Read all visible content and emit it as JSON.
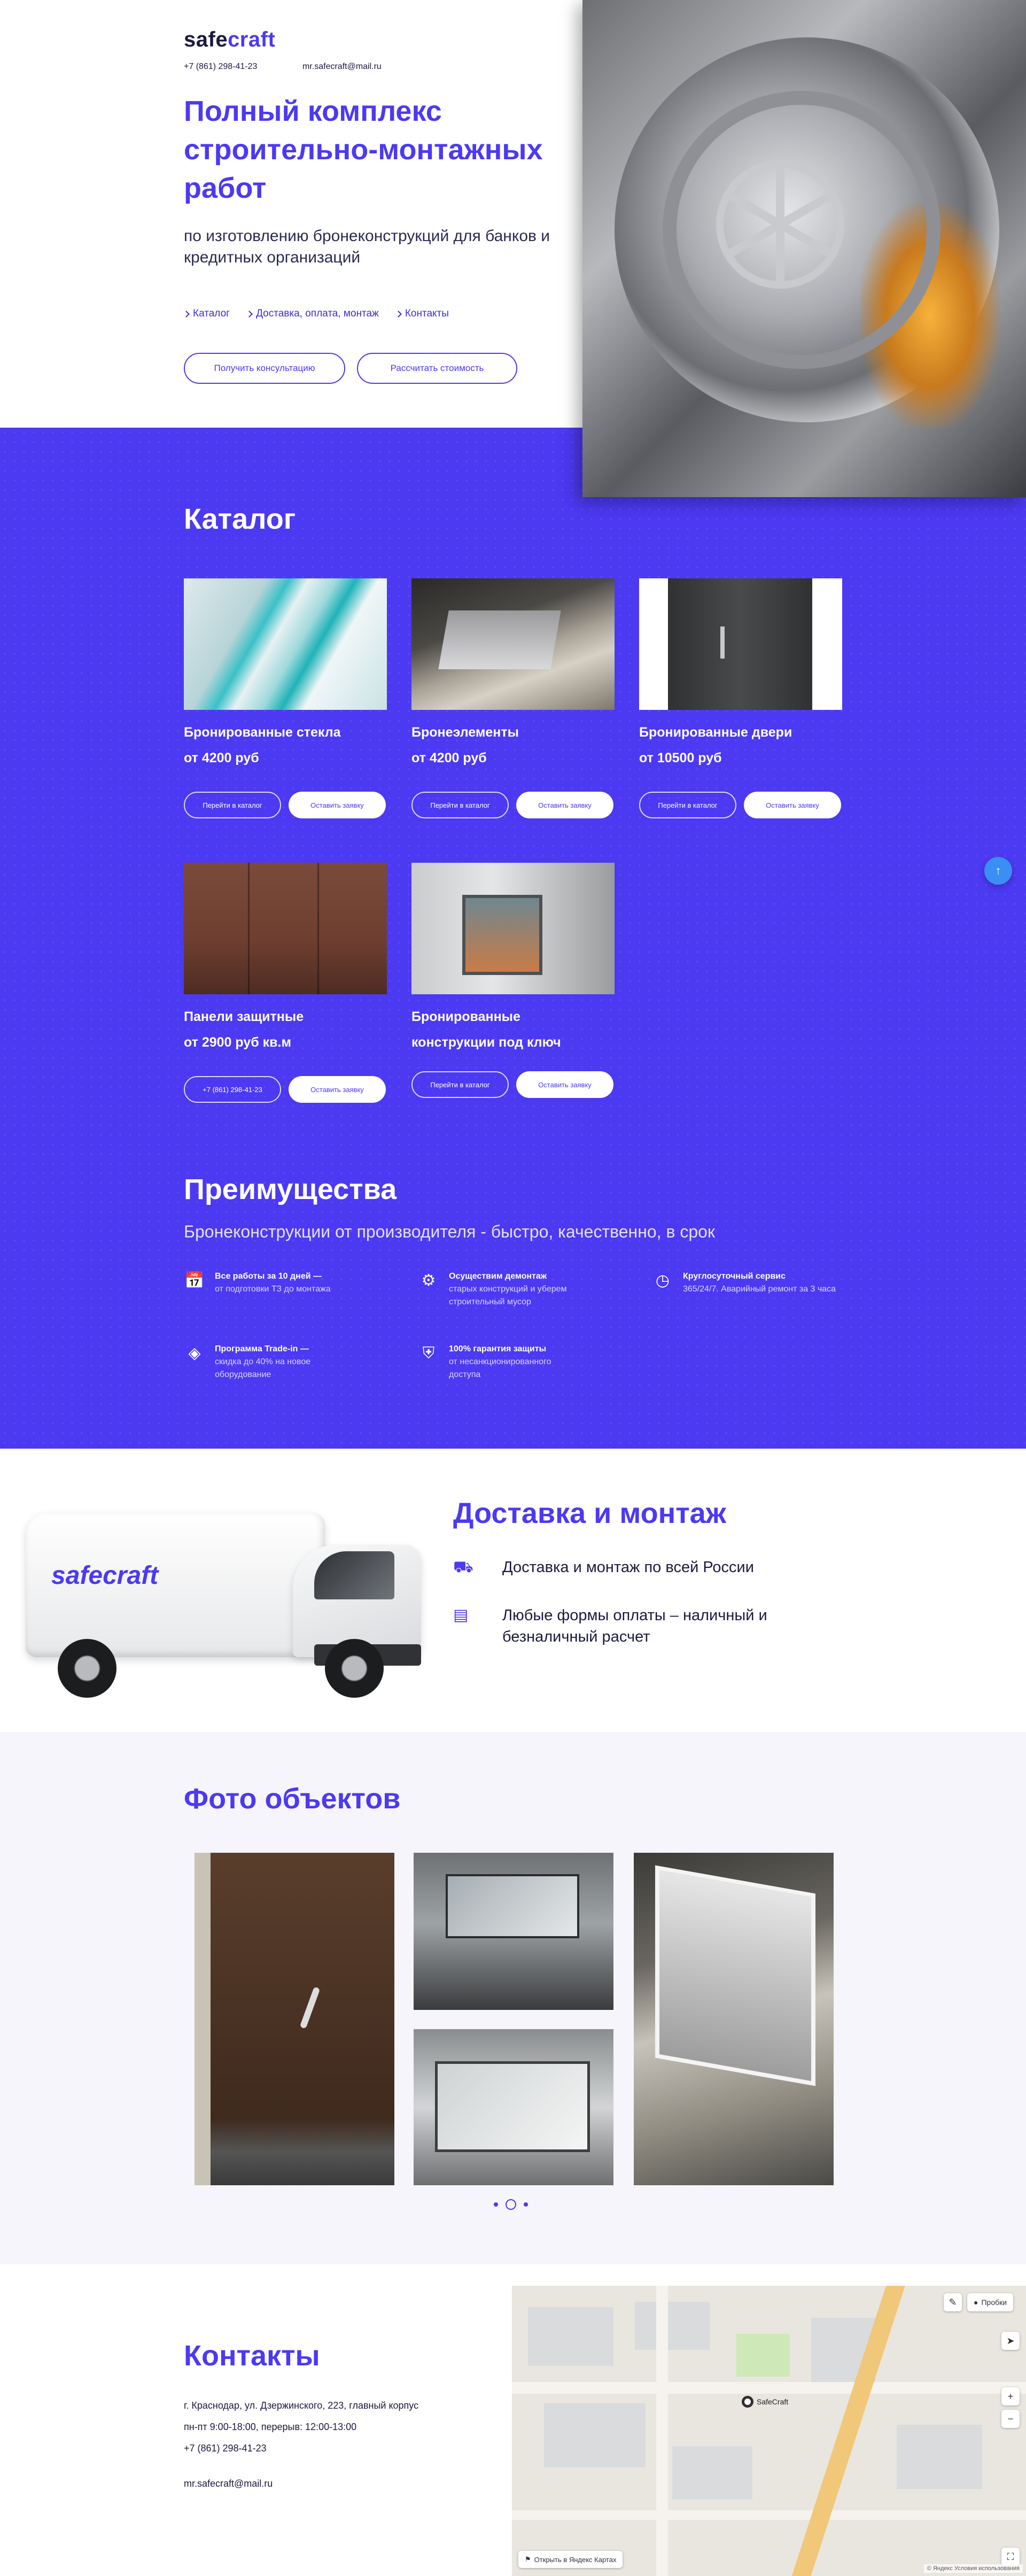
{
  "header": {
    "logo_prefix": "safe",
    "logo_suffix": "craft",
    "phone": "+7 (861) 298-41-23",
    "email": "mr.safecraft@mail.ru"
  },
  "hero": {
    "title": "Полный комплекс строительно-монтажных работ",
    "subtitle": "по изготовлению бронеконструкций для банков и кредитных организаций",
    "nav": [
      "Каталог",
      "Доставка, оплата, монтаж",
      "Контакты"
    ],
    "btn_consult": "Получить консультацию",
    "btn_calc": "Рассчитать стоимость"
  },
  "catalog": {
    "title": "Каталог",
    "items": [
      {
        "name": "Бронированные стекла",
        "price": "от 4200 руб",
        "btn1": "Перейти в каталог",
        "btn2": "Оставить заявку"
      },
      {
        "name": "Бронеэлементы",
        "price": "от 4200 руб",
        "btn1": "Перейти в каталог",
        "btn2": "Оставить заявку"
      },
      {
        "name": "Бронированные двери",
        "price": "от 10500 руб",
        "btn1": "Перейти в каталог",
        "btn2": "Оставить заявку"
      },
      {
        "name": "Панели защитные",
        "price": "от 2900 руб кв.м",
        "btn1": "+7 (861) 298-41-23",
        "btn2": "Оставить заявку"
      },
      {
        "name": "Бронированные конструкции под ключ",
        "price": "",
        "btn1": "Перейти в каталог",
        "btn2": "Оставить заявку"
      }
    ]
  },
  "advantages": {
    "title": "Преимущества",
    "subtitle": "Бронеконструкции от производителя - быстро, качественно, в срок",
    "items": [
      {
        "bold": "Все работы за 10 дней —",
        "text": "от подготовки ТЗ до монтажа",
        "icon": "calendar-clock-icon"
      },
      {
        "bold": "Осуществим демонтаж",
        "text": "старых конструкций и уберем строительный мусор",
        "icon": "gear-icon"
      },
      {
        "bold": "Круглосуточный сервис",
        "text": "365/24/7. Аварийный ремонт за 3 часа",
        "icon": "clock-24-icon"
      },
      {
        "bold": "Программа Trade-in —",
        "text": "скидка до 40% на новое оборудование",
        "icon": "tag-icon"
      },
      {
        "bold": "100% гарантия защиты",
        "text": "от несанкционированного доступа",
        "icon": "shield-check-icon"
      }
    ]
  },
  "delivery": {
    "title": "Доставка и монтаж",
    "van_logo_prefix": "safe",
    "van_logo_suffix": "craft",
    "items": [
      {
        "text": "Доставка и монтаж по всей России",
        "icon": "truck-icon"
      },
      {
        "text": "Любые формы оплаты – наличный и безналичный расчет",
        "icon": "wallet-icon"
      }
    ]
  },
  "photos": {
    "title": "Фото объектов",
    "slides": 3,
    "active": 1
  },
  "contacts": {
    "title": "Контакты",
    "address": "г. Краснодар, ул. Дзержинского, 223, главный корпус",
    "hours": "пн-пт 9:00-18:00, перерыв: 12:00-13:00",
    "phone": "+7 (861) 298-41-23",
    "email": "mr.safecraft@mail.ru"
  },
  "map": {
    "pin_label": "SafeCraft",
    "probki": "Пробки",
    "open_label": "Открыть в Яндекс Картах",
    "copyright": "© Яндекс  Условия использования"
  },
  "colors": {
    "accent": "#4c39f2",
    "dark_text": "#1b1a3f",
    "scroll_button": "#3a8ef5"
  }
}
